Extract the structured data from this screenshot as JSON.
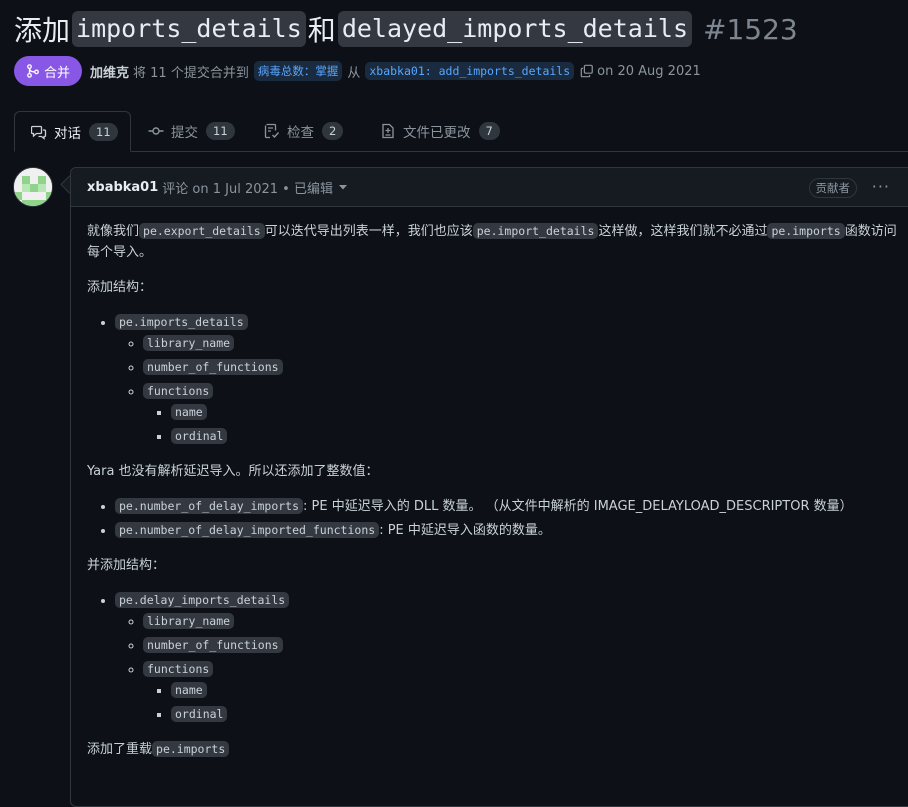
{
  "pr": {
    "title_prefix": "添加",
    "title_code_1": "imports_details",
    "title_joiner": "和",
    "title_code_2": "delayed_imports_details",
    "number": "#1523",
    "status": "合并",
    "author": "加维克",
    "summary_text": "将 11 个提交合并到",
    "base_branch": "病毒总数：掌握",
    "from_text": "从",
    "head_branch": "xbabka01: add_imports_details",
    "date": "on 20 Aug 2021"
  },
  "tabs": [
    {
      "label": "对话",
      "count": "11",
      "icon": "comment-discussion-icon"
    },
    {
      "label": "提交",
      "count": "11",
      "icon": "git-commit-icon"
    },
    {
      "label": "检查",
      "count": "2",
      "icon": "checklist-icon"
    },
    {
      "label": "文件已更改",
      "count": "7",
      "icon": "file-diff-icon"
    }
  ],
  "comment": {
    "user": "xbabka01",
    "action": "评论 on 1 Jul 2021 • 已编辑",
    "role_badge": "贡献者",
    "more": "···",
    "p1_a": "就像我们",
    "p1_code1": "pe.export_details",
    "p1_b": "可以迭代导出列表一样，我们也应该",
    "p1_code2": "pe.import_details",
    "p1_c": "这样做，这样我们就不必通过",
    "p1_code3": "pe.imports",
    "p1_d": "函数访问每个导入。",
    "p2": "添加结构：",
    "struct1": {
      "root": "pe.imports_details",
      "children": [
        "library_name",
        "number_of_functions",
        "functions"
      ],
      "fn_children": [
        "name",
        "ordinal"
      ]
    },
    "p3": "Yara 也没有解析延迟导入。所以还添加了整数值：",
    "int1_code": "pe.number_of_delay_imports",
    "int1_text": ": PE 中延迟导入的 DLL 数量。 （从文件中解析的 IMAGE_DELAYLOAD_DESCRIPTOR 数量）",
    "int2_code": "pe.number_of_delay_imported_functions",
    "int2_text": ": PE 中延迟导入函数的数量。",
    "p4": "并添加结构：",
    "struct2": {
      "root": "pe.delay_imports_details",
      "children": [
        "library_name",
        "number_of_functions",
        "functions"
      ],
      "fn_children": [
        "name",
        "ordinal"
      ]
    },
    "p5_a": "添加了重载",
    "p5_code": "pe.imports"
  }
}
